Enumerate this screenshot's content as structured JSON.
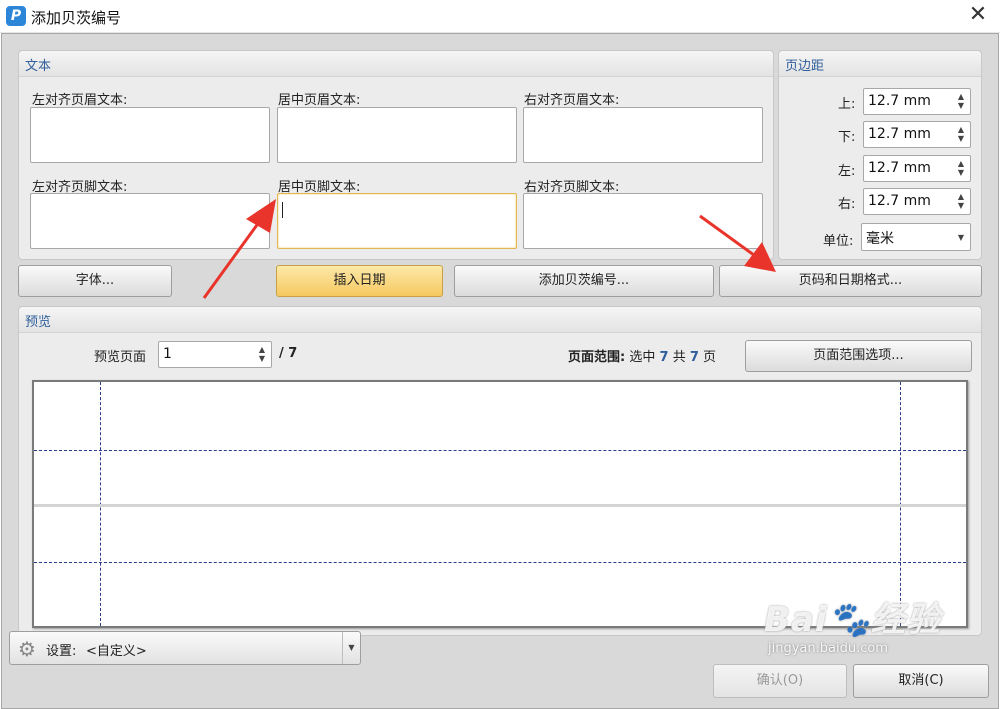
{
  "window": {
    "title": "添加贝茨编号",
    "app_icon_letter": "P",
    "close_glyph": "✕"
  },
  "text_group": {
    "title": "文本",
    "header_left_label": "左对齐页眉文本:",
    "header_center_label": "居中页眉文本:",
    "header_right_label": "右对齐页眉文本:",
    "footer_left_label": "左对齐页脚文本:",
    "footer_center_label": "居中页脚文本:",
    "footer_right_label": "右对齐页脚文本:"
  },
  "margins_group": {
    "title": "页边距",
    "top_label": "上:",
    "top_value": "12.7 mm",
    "bottom_label": "下:",
    "bottom_value": "12.7 mm",
    "left_label": "左:",
    "left_value": "12.7 mm",
    "right_label": "右:",
    "right_value": "12.7 mm",
    "unit_label": "单位:",
    "unit_value": "毫米"
  },
  "buttons": {
    "font": "字体...",
    "insert_date": "插入日期",
    "add_bates": "添加贝茨编号...",
    "page_date_format": "页码和日期格式...",
    "page_range_options": "页面范围选项...",
    "ok": "确认(O)",
    "cancel": "取消(C)"
  },
  "preview": {
    "title": "预览",
    "page_label": "预览页面",
    "page_value": "1",
    "page_total": "/ 7",
    "range_label": "页面范围:",
    "range_selected_prefix": "选中",
    "range_selected": "7",
    "range_total_prefix": "共",
    "range_total": "7",
    "range_suffix": "页"
  },
  "settings": {
    "label": "设置:",
    "value": "<自定义>"
  },
  "watermark": {
    "main": "Bai🐾经验",
    "sub": "jingyan.baidu.com"
  },
  "icons": {
    "spin": "spin-arrows-icon",
    "dropdown": "chevron-down-icon",
    "gear": "gear-icon"
  },
  "colors": {
    "accent_title": "#2f5e9b",
    "primary_button": "#f5c85f",
    "annotation_arrow": "#e8342a",
    "guide_line": "#2b3c8a"
  }
}
